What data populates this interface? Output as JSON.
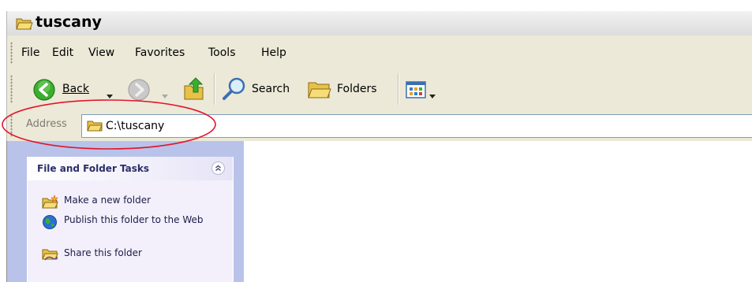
{
  "window": {
    "title": "tuscany",
    "title_icon": "folder-open-icon"
  },
  "menubar": {
    "items": [
      "File",
      "Edit",
      "View",
      "Favorites",
      "Tools",
      "Help"
    ]
  },
  "toolbar": {
    "back_label": "Back",
    "search_label": "Search",
    "folders_label": "Folders",
    "icons": [
      "back-arrow-icon",
      "forward-arrow-icon",
      "up-folder-icon",
      "search-magnifier-icon",
      "folders-icon",
      "views-icon"
    ]
  },
  "addressbar": {
    "label": "Address",
    "value": "C:\\tuscany"
  },
  "tasks": {
    "title": "File and Folder Tasks",
    "items": [
      {
        "label": "Make a new folder",
        "icon": "new-folder-icon"
      },
      {
        "label": "Publish this folder to the Web",
        "icon": "globe-publish-icon"
      },
      {
        "label": "Share this folder",
        "icon": "share-folder-icon"
      }
    ]
  },
  "annotation": {
    "color": "#e4152b",
    "shape": "ellipse",
    "target": "address-bar"
  }
}
